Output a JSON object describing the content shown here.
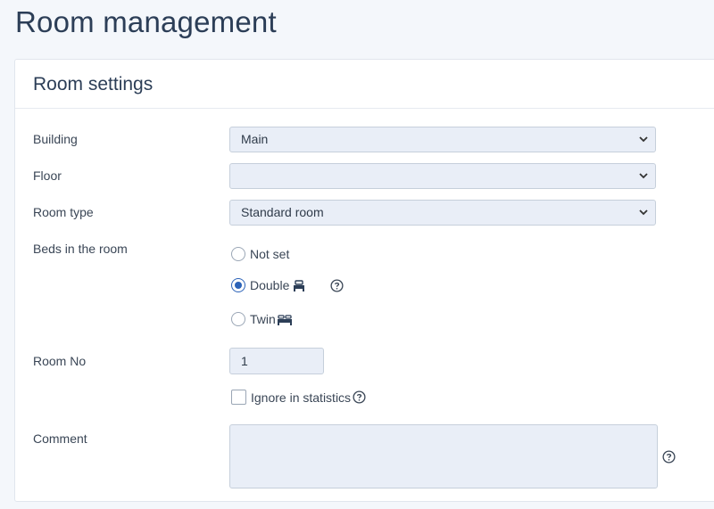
{
  "page_title": "Room management",
  "panel_title": "Room settings",
  "fields": {
    "building": {
      "label": "Building",
      "value": "Main"
    },
    "floor": {
      "label": "Floor",
      "value": ""
    },
    "room_type": {
      "label": "Room type",
      "value": "Standard room"
    },
    "beds": {
      "label": "Beds in the room",
      "options": [
        {
          "label": "Not set",
          "checked": false
        },
        {
          "label": "Double",
          "checked": true,
          "icon": "double-bed-icon"
        },
        {
          "label": "Twin",
          "checked": false,
          "icon": "twin-bed-icon"
        }
      ]
    },
    "room_no": {
      "label": "Room No",
      "value": "1"
    },
    "ignore_stats": {
      "label": "Ignore in statistics",
      "checked": false
    },
    "comment": {
      "label": "Comment",
      "value": ""
    }
  },
  "colors": {
    "accent": "#2c63b8",
    "input_bg": "#e9eef7",
    "page_bg": "#f4f7fb"
  }
}
